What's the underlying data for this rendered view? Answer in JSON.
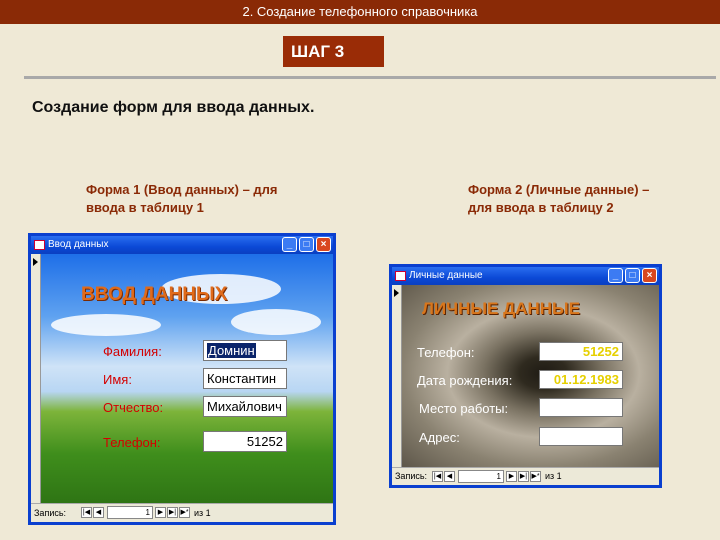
{
  "header": {
    "title": "2. Создание телефонного справочника"
  },
  "step": {
    "label": "ШАГ 3"
  },
  "heading": "Создание форм для ввода данных.",
  "captions": {
    "form1": "Форма 1 (Ввод данных) – для ввода в таблицу 1",
    "form2": "Форма 2 (Личные данные) – для ввода в таблицу 2"
  },
  "window1": {
    "title": "Ввод данных",
    "form_title": "ВВОД ДАННЫХ",
    "fields": [
      {
        "label": "Фамилия:",
        "value": "Домнин"
      },
      {
        "label": "Имя:",
        "value": "Константин"
      },
      {
        "label": "Отчество:",
        "value": "Михайлович"
      },
      {
        "label": "Телефон:",
        "value": "51252"
      }
    ],
    "nav": {
      "label": "Запись:",
      "record": "1",
      "of": "из 1"
    }
  },
  "window2": {
    "title": "Личные данные",
    "form_title": "ЛИЧНЫЕ ДАННЫЕ",
    "fields": [
      {
        "label": "Телефон:",
        "value": "51252"
      },
      {
        "label": "Дата рождения:",
        "value": "01.12.1983"
      },
      {
        "label": "Место работы:",
        "value": ""
      },
      {
        "label": "Адрес:",
        "value": ""
      }
    ],
    "nav": {
      "label": "Запись:",
      "record": "1",
      "of": "из 1"
    }
  },
  "icons": {
    "minimize": "minimize-icon",
    "maximize": "maximize-icon",
    "close": "close-icon",
    "nav_first": "first-record-icon",
    "nav_prev": "prev-record-icon",
    "nav_next": "next-record-icon",
    "nav_last": "last-record-icon",
    "nav_new": "new-record-icon"
  },
  "colors": {
    "header_bg": "#8a2a06",
    "step_bg": "#9a2c06",
    "caption": "#8a2a06",
    "window_border": "#0a3fcf"
  }
}
